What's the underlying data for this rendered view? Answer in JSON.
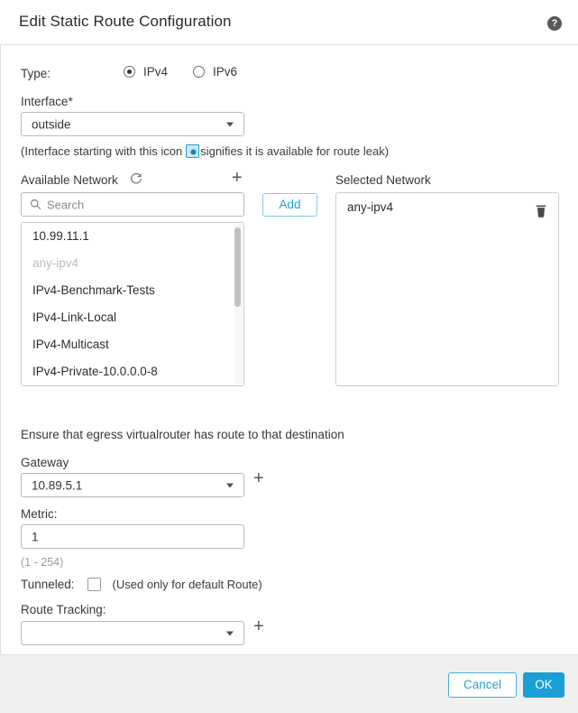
{
  "header": {
    "title": "Edit Static Route Configuration",
    "help_icon": "help-circle-icon",
    "help_glyph": "?"
  },
  "type_row": {
    "label": "Type:",
    "options": [
      {
        "label": "IPv4",
        "selected": true
      },
      {
        "label": "IPv6",
        "selected": false
      }
    ]
  },
  "interface": {
    "label": "Interface*",
    "value": "outside",
    "hint_before": "(Interface starting with this icon",
    "hint_icon": "route-leak-icon",
    "hint_after": "signifies it is available for route leak)"
  },
  "available_network": {
    "label": "Available Network",
    "refresh_icon": "refresh-icon",
    "add_new_icon": "plus-icon",
    "search_placeholder": "Search",
    "search_value": "",
    "search_icon": "search-icon",
    "add_button": "Add",
    "items": [
      {
        "label": "10.99.11.1",
        "disabled": false
      },
      {
        "label": "any-ipv4",
        "disabled": true
      },
      {
        "label": "IPv4-Benchmark-Tests",
        "disabled": false
      },
      {
        "label": "IPv4-Link-Local",
        "disabled": false
      },
      {
        "label": "IPv4-Multicast",
        "disabled": false
      },
      {
        "label": "IPv4-Private-10.0.0.0-8",
        "disabled": false
      }
    ]
  },
  "selected_network": {
    "label": "Selected Network",
    "items": [
      {
        "label": "any-ipv4",
        "delete_icon": "trash-icon"
      }
    ]
  },
  "egress_note": "Ensure that egress virtualrouter has route to that destination",
  "gateway": {
    "label": "Gateway",
    "value": "10.89.5.1",
    "add_icon": "plus-icon"
  },
  "metric": {
    "label": "Metric:",
    "value": "1",
    "range_hint": "(1 - 254)"
  },
  "tunneled": {
    "label": "Tunneled:",
    "checked": false,
    "note": "(Used only for default Route)"
  },
  "route_tracking": {
    "label": "Route Tracking:",
    "value": "",
    "add_icon": "plus-icon"
  },
  "footer": {
    "cancel_label": "Cancel",
    "ok_label": "OK"
  },
  "colors": {
    "accent_blue": "#1a9fd6",
    "link_blue": "#2a9fd6",
    "footer_bg": "#f0f0f0",
    "border_grey": "#cccccc",
    "text_dark": "#2b2b2b",
    "text_muted": "#9a9a9a"
  }
}
